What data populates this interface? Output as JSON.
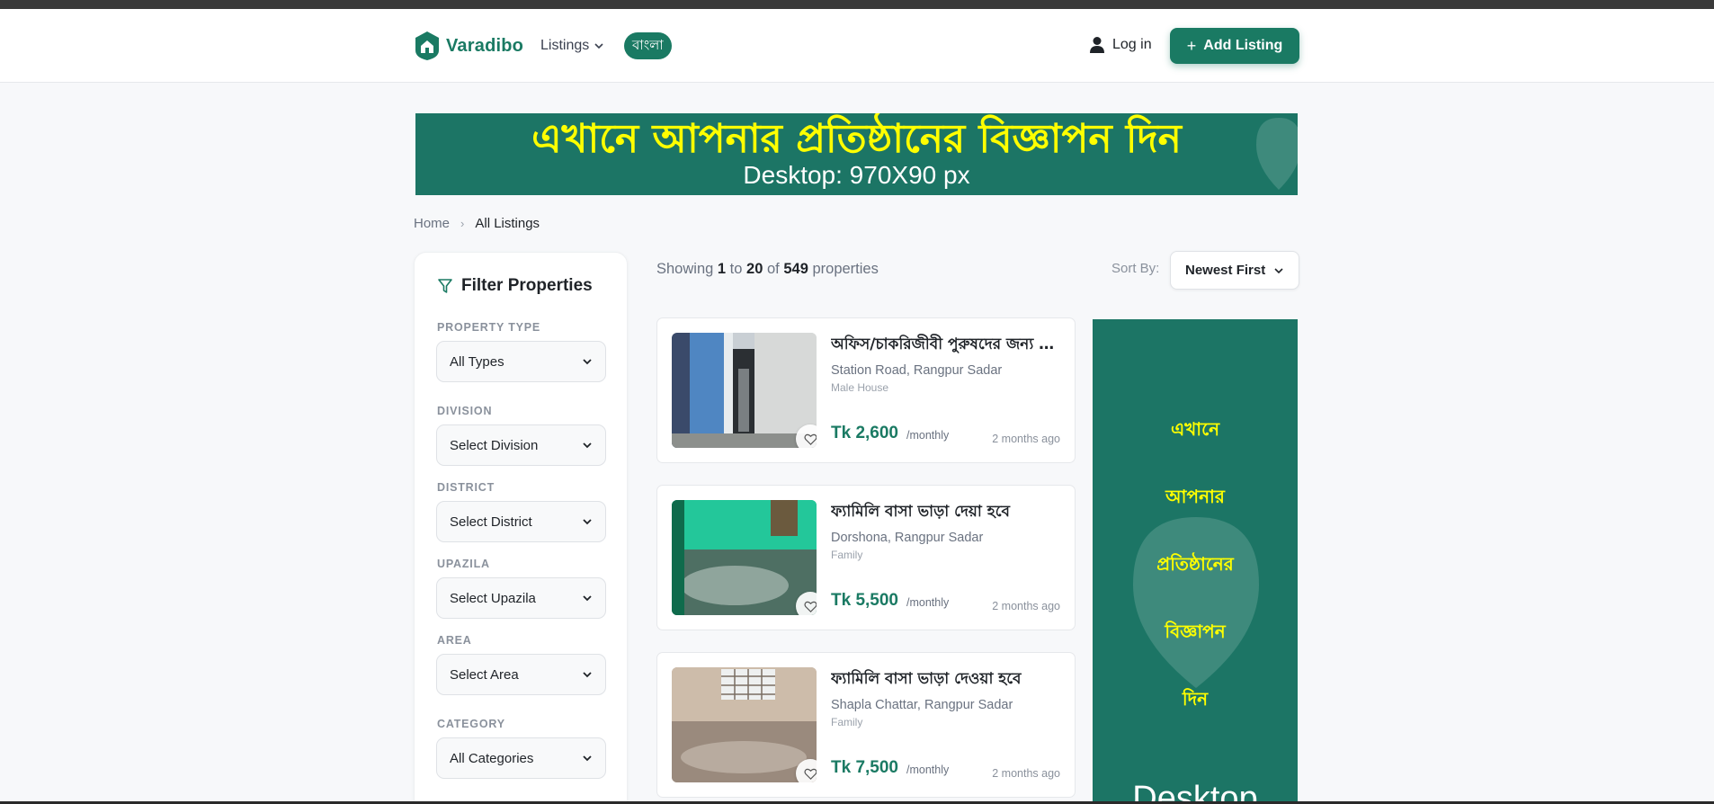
{
  "header": {
    "brand": "Varadibo",
    "nav_listings": "Listings",
    "language_toggle": "বাংলা",
    "login": "Log in",
    "add_listing": "Add Listing"
  },
  "banner": {
    "line1": "এখানে আপনার প্রতিষ্ঠানের বিজ্ঞাপন দিন",
    "line2": "Desktop: 970X90 px"
  },
  "breadcrumb": {
    "home": "Home",
    "current": "All Listings"
  },
  "filter": {
    "title": "Filter Properties",
    "fields": [
      {
        "label": "PROPERTY TYPE",
        "value": "All Types"
      },
      {
        "label": "DIVISION",
        "value": "Select Division"
      },
      {
        "label": "DISTRICT",
        "value": "Select District"
      },
      {
        "label": "UPAZILA",
        "value": "Select Upazila"
      },
      {
        "label": "AREA",
        "value": "Select Area"
      },
      {
        "label": "CATEGORY",
        "value": "All Categories"
      }
    ]
  },
  "results": {
    "showing_prefix": "Showing",
    "from": "1",
    "to_word": "to",
    "to": "20",
    "of_word": "of",
    "total": "549",
    "suffix": "properties",
    "sort_label": "Sort By:",
    "sort_value": "Newest First"
  },
  "listings": [
    {
      "title": "অফিস/চাকরিজীবী পুরুষদের জন্য সিট ভাড়া",
      "location": "Station Road, Rangpur Sadar",
      "category": "Male House",
      "price": "Tk 2,600",
      "period": "/monthly",
      "posted": "2 months ago"
    },
    {
      "title": "ফ্যামিলি বাসা ভাড়া দেয়া হবে",
      "location": "Dorshona, Rangpur Sadar",
      "category": "Family",
      "price": "Tk 5,500",
      "period": "/monthly",
      "posted": "2 months ago"
    },
    {
      "title": "ফ্যামিলি বাসা ভাড়া দেওয়া হবে",
      "location": "Shapla Chattar, Rangpur Sadar",
      "category": "Family",
      "price": "Tk 7,500",
      "period": "/monthly",
      "posted": "2 months ago"
    }
  ],
  "side_ad": {
    "lines": [
      "এখানে",
      "আপনার",
      "প্রতিষ্ঠানের",
      "বিজ্ঞাপন",
      "দিন"
    ],
    "footer": "Desktop"
  },
  "colors": {
    "brand": "#1a7a63",
    "ad_bg": "#1c7565",
    "ad_text": "#ffff00"
  },
  "icons": [
    "house-logo-icon",
    "chevron-down-icon",
    "user-icon",
    "plus-icon",
    "filter-icon",
    "heart-icon"
  ]
}
